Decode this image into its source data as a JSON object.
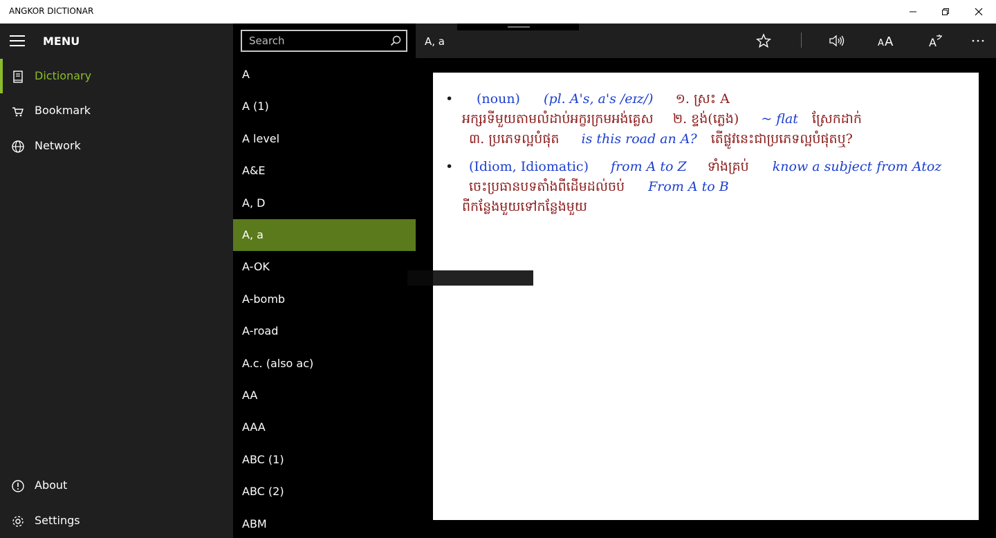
{
  "window": {
    "title": "ANGKOR DICTIONAR",
    "minimize_icon": "minimize-icon",
    "restore_icon": "restore-icon",
    "close_icon": "close-icon"
  },
  "nav": {
    "menu_label": "MENU",
    "items": [
      {
        "label": "Dictionary",
        "icon": "book-icon",
        "active": true
      },
      {
        "label": "Bookmark",
        "icon": "basket-icon",
        "active": false
      },
      {
        "label": "Network",
        "icon": "globe-icon",
        "active": false
      }
    ],
    "bottom_items": [
      {
        "label": "About",
        "icon": "info-icon"
      },
      {
        "label": "Settings",
        "icon": "gear-icon"
      }
    ],
    "accent_color": "#8bbd2a"
  },
  "search": {
    "placeholder": "Search"
  },
  "word_list": {
    "selected_index": 5,
    "selected_color": "#5a7a1c",
    "words": [
      "A",
      "A (1)",
      "A level",
      "A&E",
      "A, D",
      "A, a",
      "A-OK",
      "A-bomb",
      "A-road",
      "A.c. (also ac)",
      "AA",
      "AAA",
      "ABC (1)",
      "ABC (2)",
      "ABM"
    ]
  },
  "entry": {
    "headword": "A, a",
    "toolbar_icons": [
      "star-icon",
      "speaker-icon",
      "font-size-icon",
      "translate-icon",
      "more-icon"
    ],
    "definition": {
      "bullet": "•",
      "pos1": "(noun)",
      "plural": "(pl. A's, a's /eɪz/)",
      "sense1": "១. ស្រះ A",
      "sense1_cont": "អក្សរទីមួយតាមលំដាប់អក្ខរក្រមអង់គ្លេស",
      "sense2": "២. ខ្ទង់(ភ្លេង)",
      "ex_flat": "~ flat",
      "ex_flat_km": "ស្រែកដាក់",
      "sense3": "៣. ប្រភេទល្អបំផុត",
      "ex_road": "is this road an A?",
      "ex_road_km": "តើផ្លូវនេះជាប្រភេទល្អបំផុតឬ?",
      "pos2": "(Idiom, Idiomatic)",
      "idiom1": "from A to Z",
      "idiom1_km": "ទាំងគ្រប់",
      "idiom1_ex": "know a subject from Atoz",
      "idiom1_ex_km": "ចេះប្រធានបទតាំងពីដើមដល់ចប់",
      "idiom2": "From A to B",
      "idiom2_km": "ពីកន្លែងមួយទៅកន្លែងមួយ"
    },
    "colors": {
      "khmer": "#8b1a1a",
      "english": "#1c3fd0"
    }
  }
}
